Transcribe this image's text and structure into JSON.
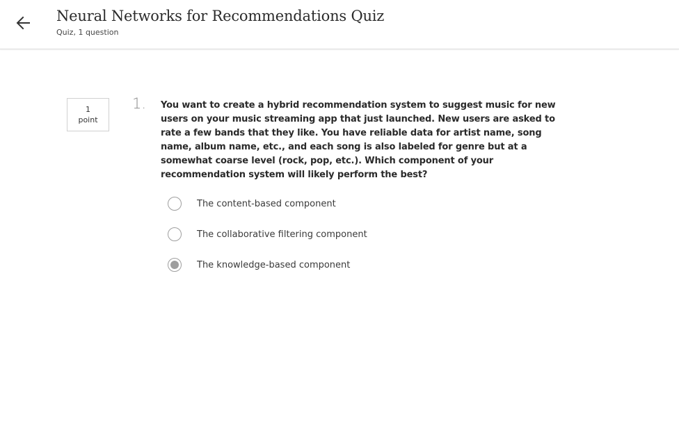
{
  "header": {
    "title": "Neural Networks for Recommendations Quiz",
    "subtitle": "Quiz, 1 question",
    "back_icon": "arrow-left-icon"
  },
  "question": {
    "points_value": "1",
    "points_label": "point",
    "number": "1.",
    "text": "You want to create a hybrid recommendation system to suggest music for new users on your music streaming app that just launched. New users are asked to rate a few bands that they like. You have reliable data for artist name, song name, album name, etc., and each song is also labeled for genre but at a somewhat coarse level (rock, pop, etc.). Which component of your recommendation system will likely perform the best?",
    "options": [
      {
        "label": "The content-based component",
        "selected": false
      },
      {
        "label": "The collaborative filtering component",
        "selected": false
      },
      {
        "label": "The knowledge-based component",
        "selected": true
      }
    ]
  },
  "colors": {
    "radio_border": "#9e9e9e",
    "radio_fill": "#9e9e9e",
    "header_border": "#dcdcdc"
  }
}
